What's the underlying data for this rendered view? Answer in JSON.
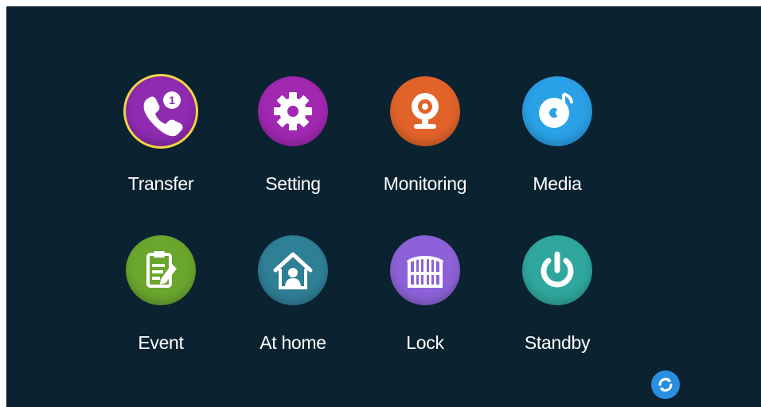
{
  "menu": {
    "items": [
      {
        "label": "Transfer",
        "icon": "phone-badge-icon",
        "color": "#8e2bb0",
        "badge": "1"
      },
      {
        "label": "Setting",
        "icon": "gear-icon",
        "color": "#a128b0"
      },
      {
        "label": "Monitoring",
        "icon": "webcam-icon",
        "color": "#e2632a"
      },
      {
        "label": "Media",
        "icon": "media-note-icon",
        "color": "#2aa0e6"
      },
      {
        "label": "Event",
        "icon": "clipboard-edit-icon",
        "color": "#6aa62e"
      },
      {
        "label": "At home",
        "icon": "home-person-icon",
        "color": "#2f7f96"
      },
      {
        "label": "Lock",
        "icon": "gate-icon",
        "color": "#8d62d8"
      },
      {
        "label": "Standby",
        "icon": "power-icon",
        "color": "#2fa79d"
      }
    ]
  },
  "refresh": {
    "icon": "refresh-icon",
    "color": "#2a8fe0"
  },
  "colors": {
    "background": "#0b2231",
    "selection_ring": "#f2d544",
    "label": "#ffffff"
  }
}
